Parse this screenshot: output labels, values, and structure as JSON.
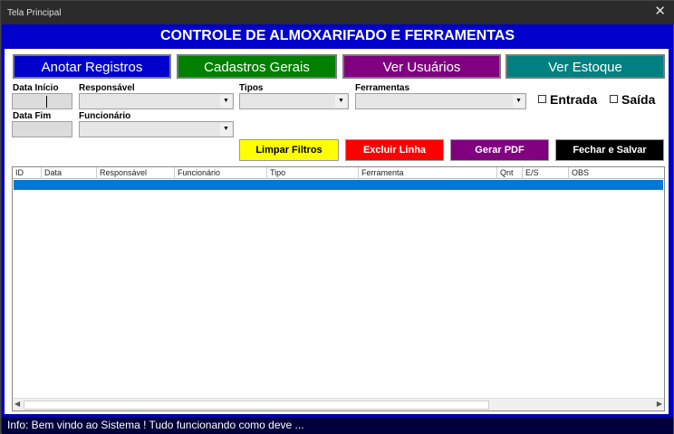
{
  "window": {
    "title": "Tela Principal",
    "close_glyph": "✕"
  },
  "header": {
    "title": "CONTROLE DE ALMOXARIFADO E FERRAMENTAS"
  },
  "nav": {
    "registros": "Anotar Registros",
    "cadastros": "Cadastros Gerais",
    "usuarios": "Ver Usuários",
    "estoque": "Ver Estoque"
  },
  "filters": {
    "data_inicio": "Data Início",
    "data_fim": "Data Fim",
    "responsavel": "Responsável",
    "funcionario": "Funcionário",
    "tipos": "Tipos",
    "ferramentas": "Ferramentas",
    "entrada": "Entrada",
    "saida": "Saída"
  },
  "actions": {
    "limpar": "Limpar Filtros",
    "excluir": "Excluir Linha",
    "pdf": "Gerar PDF",
    "fechar": "Fechar e Salvar"
  },
  "table": {
    "columns": [
      "ID",
      "Data",
      "Responsável",
      "Funcionário",
      "Tipo",
      "Ferramenta",
      "Qnt",
      "E/S",
      "OBS"
    ]
  },
  "status": {
    "text": "Info:  Bem vindo ao Sistema ! Tudo funcionando como deve ..."
  },
  "colors": {
    "background": "#0000cc",
    "registros": "#0000cc",
    "cadastros": "#008000",
    "usuarios": "#800080",
    "estoque": "#008080",
    "limpar": "#ffff00",
    "excluir": "#ff0000",
    "pdf": "#800080",
    "fechar": "#000000",
    "selection": "#0078d7"
  }
}
